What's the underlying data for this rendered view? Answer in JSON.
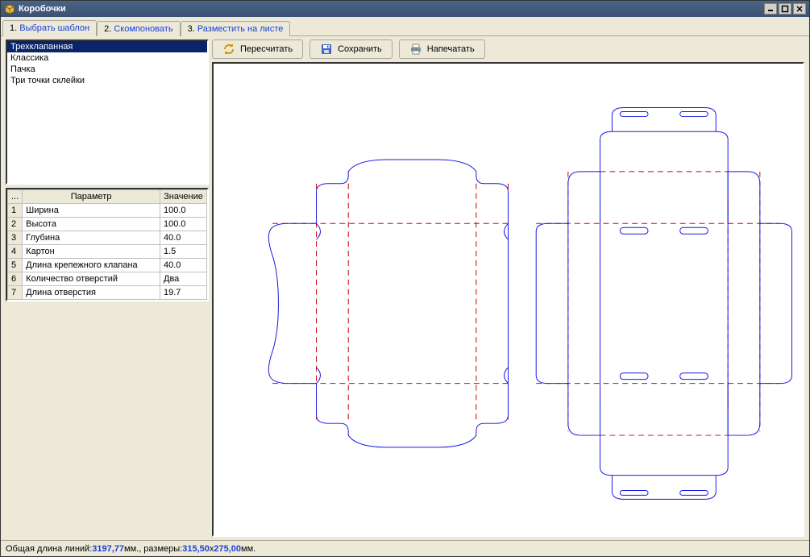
{
  "window": {
    "title": "Коробочки"
  },
  "tabs": [
    {
      "num": "1.",
      "label": "Выбрать шаблон"
    },
    {
      "num": "2.",
      "label": "Скомпоновать"
    },
    {
      "num": "3.",
      "label": "Разместить на листе"
    }
  ],
  "templates": {
    "items": [
      "Трехклапанная",
      "Классика",
      "Пачка",
      "Три точки склейки"
    ],
    "selectedIndex": 0
  },
  "paramGrid": {
    "cornerHeader": "...",
    "colParam": "Параметр",
    "colValue": "Значение",
    "rows": [
      {
        "n": "1",
        "name": "Ширина",
        "val": "100.0"
      },
      {
        "n": "2",
        "name": "Высота",
        "val": "100.0"
      },
      {
        "n": "3",
        "name": "Глубина",
        "val": "40.0"
      },
      {
        "n": "4",
        "name": "Картон",
        "val": "1.5"
      },
      {
        "n": "5",
        "name": "Длина крепежного клапана",
        "val": "40.0"
      },
      {
        "n": "6",
        "name": "Количество отверстий",
        "val": "Два"
      },
      {
        "n": "7",
        "name": "Длина отверстия",
        "val": "19.7"
      }
    ]
  },
  "toolbar": {
    "recalc": "Пересчитать",
    "save": "Сохранить",
    "print": "Напечатать"
  },
  "status": {
    "prefix": "Общая длина линий: ",
    "length": "3197,77",
    "mid1": " мм., размеры: ",
    "w": "315,50",
    "mid2": " x ",
    "h": "275,00",
    "suffix": " мм."
  },
  "colors": {
    "cut": "#1a1ae6",
    "fold": "#d00000"
  }
}
